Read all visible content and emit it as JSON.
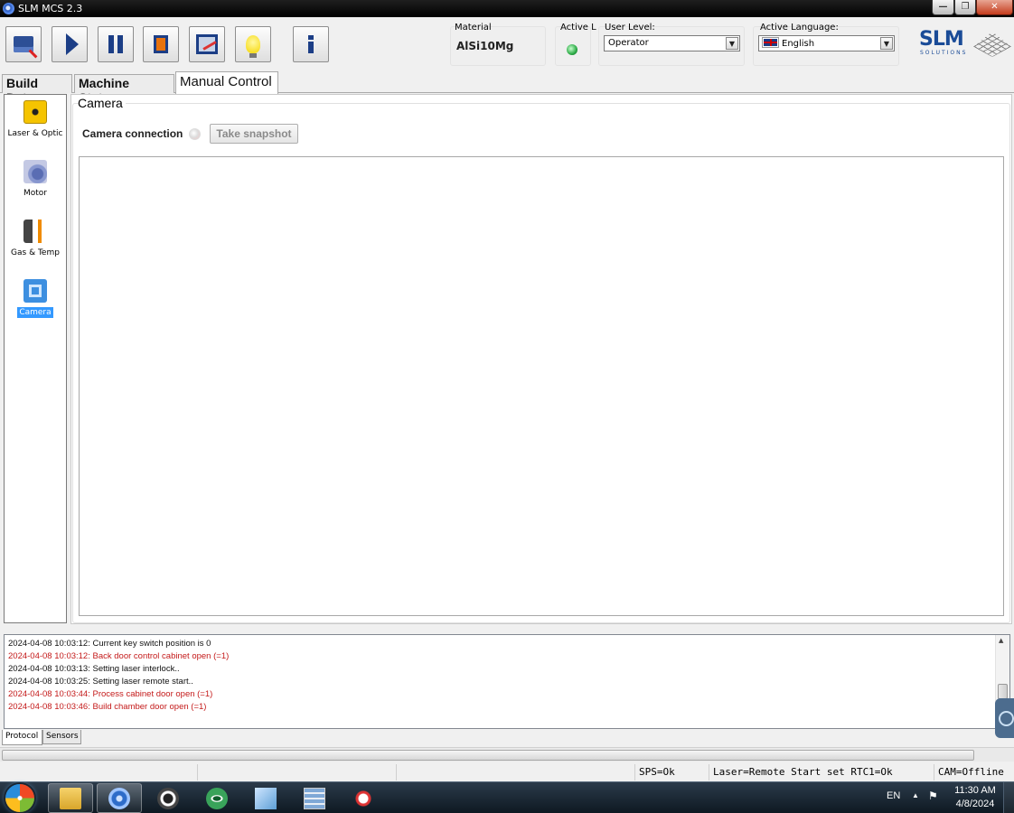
{
  "window": {
    "title": "SLM MCS 2.3"
  },
  "toolbar": {
    "material_label": "Material",
    "material_value": "AlSi10Mg",
    "active_label": "Active L",
    "user_level_label": "User Level:",
    "user_level_value": "Operator",
    "language_label": "Active Language:",
    "language_value": "English",
    "logo_text": "SLM",
    "logo_sub": "SOLUTIONS"
  },
  "tabs": [
    "Build Data",
    "Machine Status",
    "Manual Control"
  ],
  "active_tab": "Manual Control",
  "nav": {
    "items": [
      {
        "label": "Laser & Optic",
        "icon": "laser-icon"
      },
      {
        "label": "Motor",
        "icon": "motor-icon"
      },
      {
        "label": "Gas & Temp",
        "icon": "gas-temp-icon"
      },
      {
        "label": "Camera",
        "icon": "camera-icon"
      }
    ],
    "active": "Camera"
  },
  "camera_panel": {
    "title": "Camera",
    "connection_label": "Camera connection",
    "snapshot_label": "Take snapshot"
  },
  "log": [
    {
      "text": "2024-04-08 10:03:12: Current key switch position is 0",
      "level": "info"
    },
    {
      "text": "2024-04-08 10:03:12: Back door control cabinet open (=1)",
      "level": "error"
    },
    {
      "text": "2024-04-08 10:03:13: Setting laser interlock..",
      "level": "info"
    },
    {
      "text": "2024-04-08 10:03:25: Setting laser remote start..",
      "level": "info"
    },
    {
      "text": "2024-04-08 10:03:44: Process cabinet door open (=1)",
      "level": "error"
    },
    {
      "text": "2024-04-08 10:03:46: Build chamber door open (=1)",
      "level": "error"
    }
  ],
  "log_tabs": [
    "Protocol",
    "Sensors"
  ],
  "statusbar": {
    "sps": "SPS=Ok",
    "laser": "Laser=Remote Start set RTC1=Ok",
    "cam": "CAM=Offline"
  },
  "taskbar": {
    "lang": "EN",
    "time": "11:30 AM",
    "date": "4/8/2024"
  },
  "colors": {
    "error_text": "#c41a1a",
    "selection": "#3399ff",
    "brand": "#1a4b97"
  }
}
